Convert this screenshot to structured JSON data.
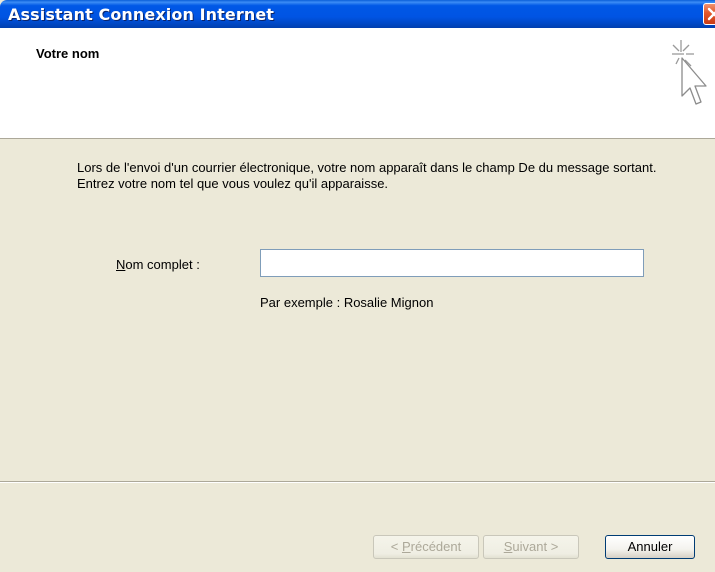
{
  "window": {
    "title": "Assistant Connexion Internet",
    "close_icon": "close-icon"
  },
  "header": {
    "title": "Votre nom",
    "icon": "wizard-cursor-icon"
  },
  "main": {
    "intro_text": "Lors de l'envoi d'un courrier électronique, votre nom apparaît dans le champ De du message sortant. Entrez votre nom tel que vous voulez qu'il apparaisse.",
    "name_field": {
      "label_accesskey": "N",
      "label_rest": "om complet :",
      "value": "",
      "example": "Par exemple : Rosalie Mignon"
    }
  },
  "buttons": {
    "previous": {
      "prefix": "< ",
      "accesskey": "P",
      "rest": "récédent",
      "enabled": false
    },
    "next": {
      "accesskey": "S",
      "rest": "uivant",
      "suffix": " >",
      "enabled": false
    },
    "cancel": {
      "label": "Annuler",
      "enabled": true
    }
  },
  "colors": {
    "titlebar": "#0054e3",
    "dialog_background": "#ece9d8",
    "header_background": "#ffffff",
    "close_button": "#e2572a"
  }
}
